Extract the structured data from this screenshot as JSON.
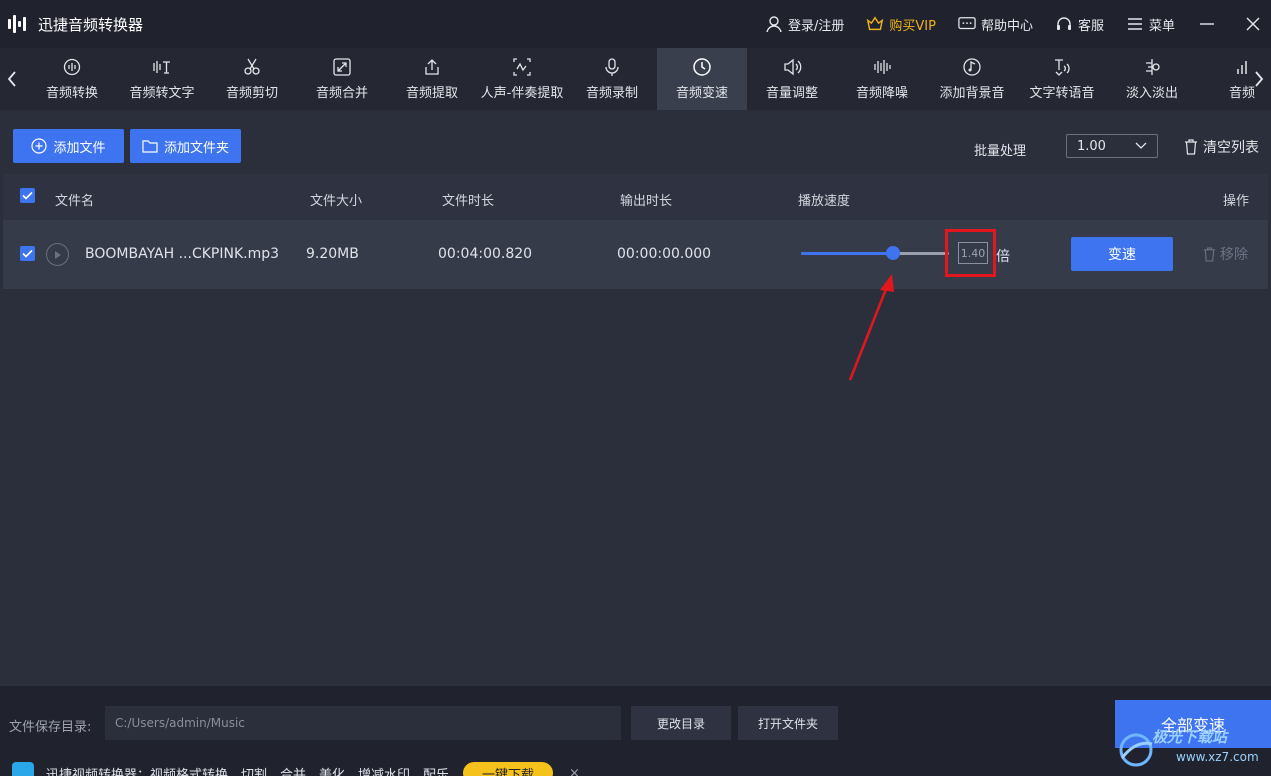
{
  "app": {
    "title": "迅捷音频转换器"
  },
  "titlebar": {
    "login": "登录/注册",
    "vip": "购买VIP",
    "help": "帮助中心",
    "service": "客服",
    "menu": "菜单"
  },
  "tools": [
    {
      "label": "音频转换",
      "icon": "audio-convert-icon"
    },
    {
      "label": "音频转文字",
      "icon": "audio-to-text-icon"
    },
    {
      "label": "音频剪切",
      "icon": "scissors-icon"
    },
    {
      "label": "音频合并",
      "icon": "merge-icon"
    },
    {
      "label": "音频提取",
      "icon": "extract-icon"
    },
    {
      "label": "人声-伴奏提取",
      "icon": "vocal-separate-icon"
    },
    {
      "label": "音频录制",
      "icon": "microphone-icon"
    },
    {
      "label": "音频变速",
      "icon": "speed-icon",
      "active": true
    },
    {
      "label": "音量调整",
      "icon": "volume-icon"
    },
    {
      "label": "音频降噪",
      "icon": "noise-reduce-icon"
    },
    {
      "label": "添加背景音",
      "icon": "music-note-icon"
    },
    {
      "label": "文字转语音",
      "icon": "text-to-speech-icon"
    },
    {
      "label": "淡入淡出",
      "icon": "fade-icon"
    },
    {
      "label": "音频",
      "icon": "audio-icon"
    }
  ],
  "actions": {
    "add_file": "添加文件",
    "add_folder": "添加文件夹",
    "batch_label": "批量处理",
    "batch_value": "1.00",
    "clear_list": "清空列表"
  },
  "table": {
    "headers": {
      "name": "文件名",
      "size": "文件大小",
      "duration": "文件时长",
      "output_duration": "输出时长",
      "speed": "播放速度",
      "action": "操作"
    },
    "rows": [
      {
        "name": "BOOMBAYAH ...CKPINK.mp3",
        "size": "9.20MB",
        "duration": "00:04:00.820",
        "output_duration": "00:00:00.000",
        "speed_value": "1.40",
        "speed_unit": "倍",
        "speed_fraction": 0.62,
        "action_label": "变速",
        "remove_label": "移除"
      }
    ]
  },
  "footer": {
    "save_label": "文件保存目录:",
    "save_path": "C:/Users/admin/Music",
    "change_dir": "更改目录",
    "open_folder": "打开文件夹",
    "convert_all": "全部变速",
    "promo_text": "迅捷视频转换器：视频格式转换、切割、合并、美化、增减水印、配乐",
    "promo_button": "一键下载",
    "promo_close": "×"
  },
  "watermark": {
    "line1": "极光下载站",
    "line2": "www.xz7.com"
  },
  "colors": {
    "accent": "#3e74f0",
    "highlight": "#e3161d",
    "vip": "#f0b21a"
  }
}
